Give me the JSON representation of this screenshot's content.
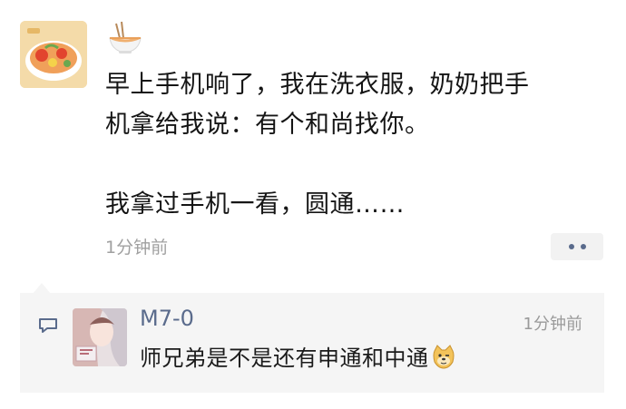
{
  "post": {
    "author_avatar": "food-bowl-avatar",
    "author_name_emoji": "noodle-bowl-icon",
    "paragraphs": [
      "早上手机响了，我在洗衣服，奶奶把手",
      "机拿给我说：有个和尚找你。",
      "我拿过手机一看，圆通……"
    ],
    "time": "1分钟前"
  },
  "comment": {
    "icon": "comment-bubble-icon",
    "author_avatar": "anime-girl-avatar",
    "author": "M7-0",
    "time": "1分钟前",
    "text": "师兄弟是不是还有申通和中通",
    "emoji": "doge-emoji-icon"
  },
  "colors": {
    "name_link": "#5a6b8c",
    "timestamp": "#a0a0a0",
    "comment_bg": "#f5f5f5"
  }
}
